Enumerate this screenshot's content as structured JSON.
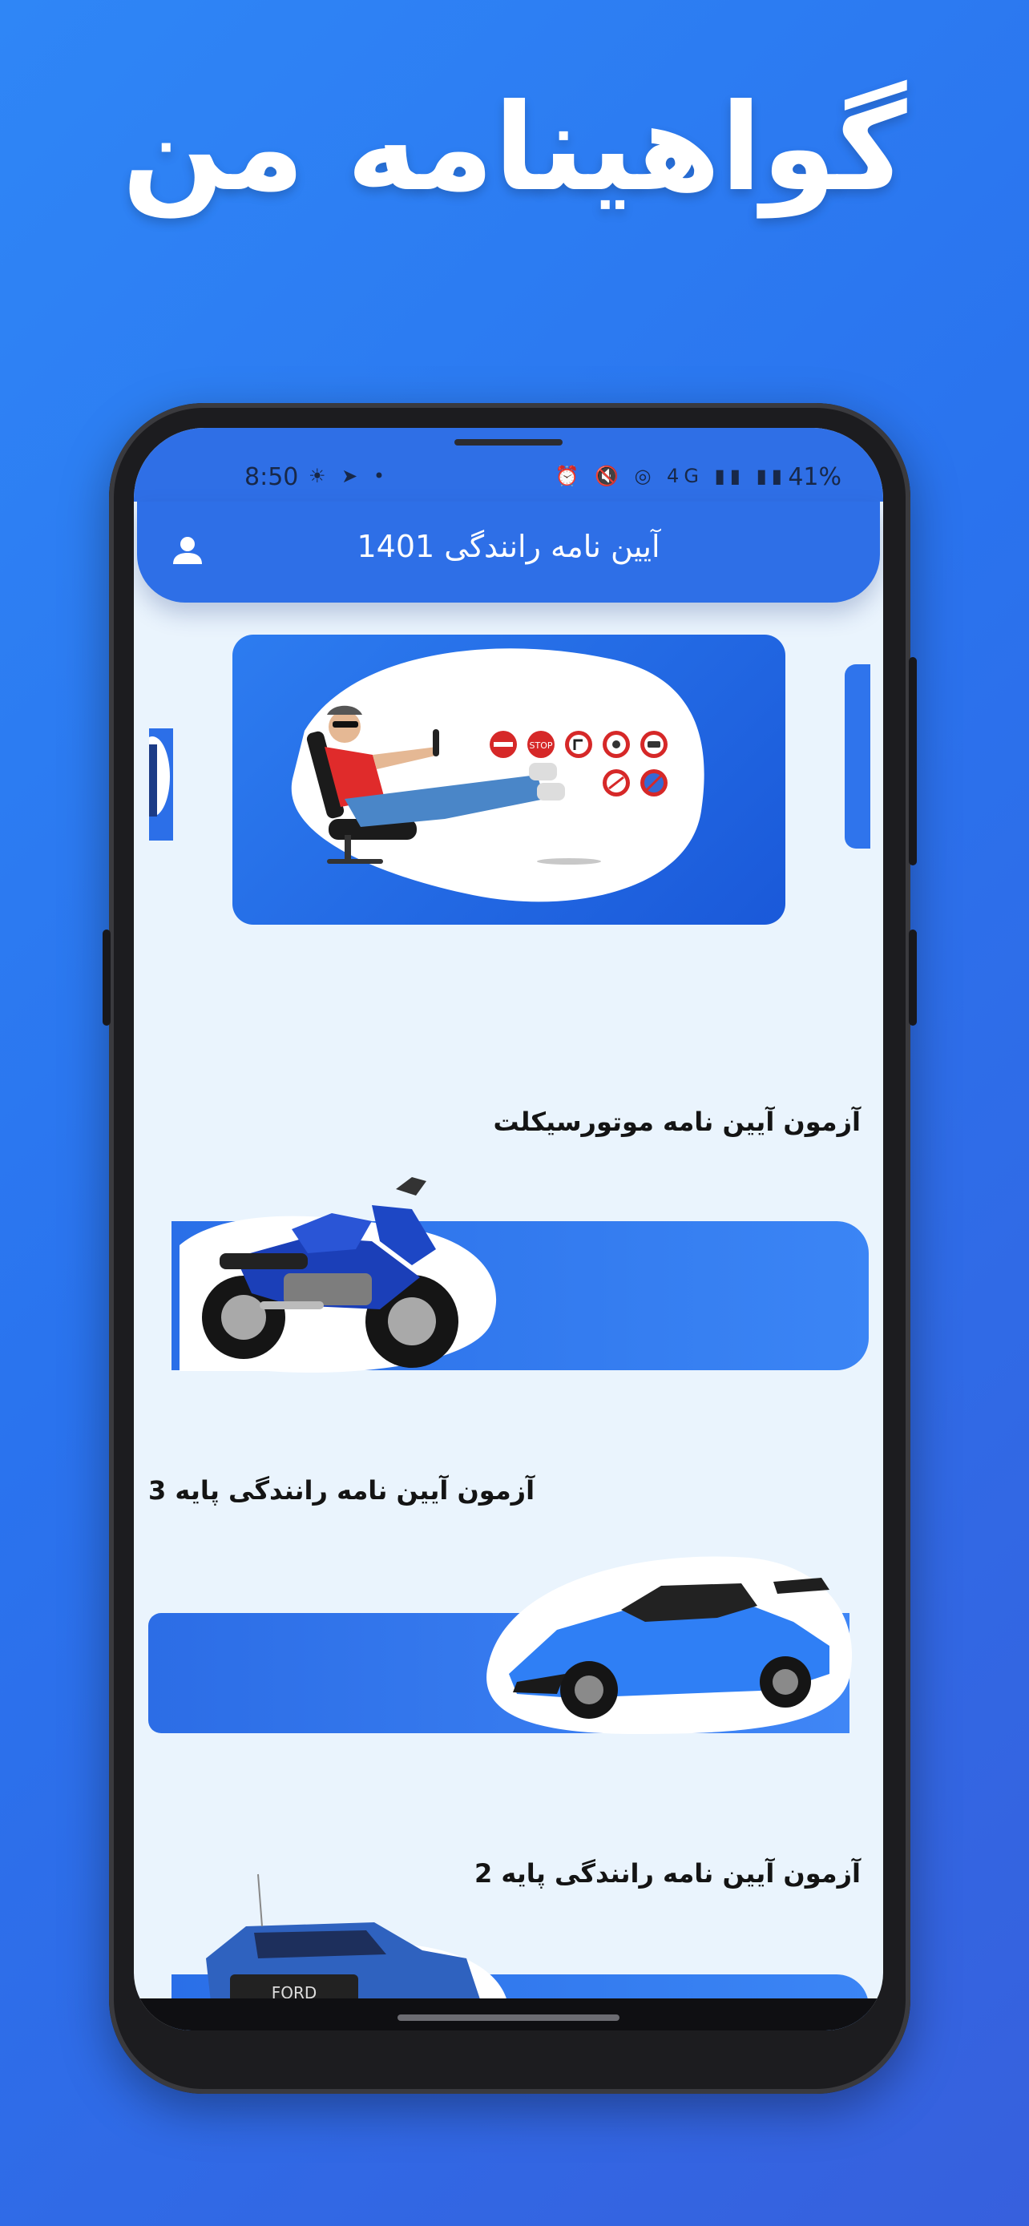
{
  "hero": {
    "title": "گواهینامه من"
  },
  "status_bar": {
    "time": "8:50",
    "left_icons": "☀ ➤ •",
    "right_icons": "⏰ 🔇 ◎ 4G ▮▮ ▮▮",
    "battery": "41%"
  },
  "app_bar": {
    "title": "آیین نامه رانندگی 1401",
    "profile_icon": "person-icon"
  },
  "items": [
    {
      "title": "آزمون آیین نامه موتورسیکلت",
      "image": "motorcycle"
    },
    {
      "title": "آزمون آیین نامه رانندگی پایه 3",
      "image": "sports-car"
    },
    {
      "title": "آزمون آیین نامه رانندگی پایه 2",
      "image": "pickup-truck"
    }
  ],
  "colors": {
    "background": "#2f86f6",
    "app_bar": "#2e6fe7",
    "screen": "#eaf4fd",
    "card": "#2a6fe8"
  }
}
